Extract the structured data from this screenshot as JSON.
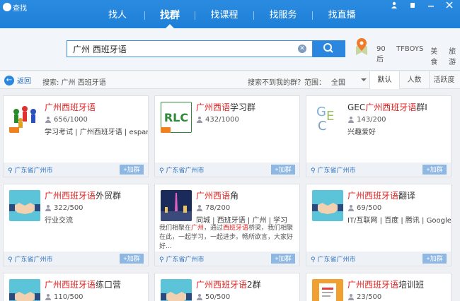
{
  "app": {
    "title": "查找"
  },
  "nav": [
    {
      "label": "找人",
      "active": false
    },
    {
      "label": "找群",
      "active": true
    },
    {
      "label": "找课程",
      "active": false
    },
    {
      "label": "找服务",
      "active": false
    },
    {
      "label": "找直播",
      "active": false
    }
  ],
  "search": {
    "value": "广州 西班牙语",
    "hot_tags": [
      "90后",
      "TFBOYS",
      "美食",
      "旅游"
    ]
  },
  "filter": {
    "back_label": "返回",
    "search_info": "搜索: 广州 西班牙语",
    "not_found": "搜索不到我的群？",
    "range_label": "范围：",
    "range_value": "全国",
    "sort_tabs": [
      {
        "label": "默认",
        "active": true
      },
      {
        "label": "人数",
        "active": false
      },
      {
        "label": "活跃度",
        "active": false
      }
    ]
  },
  "cards": [
    {
      "name_hl": "广州西班牙语",
      "name_rest": "",
      "count": "656/1000",
      "tags": "学习考试 | 广州西班牙语 | espanol",
      "desc_parts": [],
      "location": "广东省广州市",
      "join": "+加群",
      "thumb": "people"
    },
    {
      "name_hl": "广州西",
      "name_mid": "语",
      "name_rest": "学习群",
      "count": "432/1000",
      "tags": "",
      "desc_parts": [],
      "location": "广东省广州市",
      "join": "+加群",
      "thumb": "rlc"
    },
    {
      "name_pre": "GEC",
      "name_hl": "广州西班牙语",
      "name_rest": "群I",
      "count": "143/200",
      "tags": "兴趣爱好",
      "desc_parts": [],
      "location": "广东省广州市",
      "join": "+加群",
      "thumb": "gec"
    },
    {
      "name_hl": "广州西班牙语",
      "name_rest": "外贸群",
      "count": "322/500",
      "tags": "行业交流",
      "desc_parts": [],
      "location": "广东省广州市",
      "join": "+加群",
      "thumb": "hand"
    },
    {
      "name_hl": "广州西",
      "name_mid": "语",
      "name_rest": "角",
      "count": "78/200",
      "tags": "同城 | 西班牙语 | 广州 | 学习",
      "desc_parts": [
        {
          "t": "我们相聚在",
          "h": false
        },
        {
          "t": "广州",
          "h": true
        },
        {
          "t": "，通过",
          "h": false
        },
        {
          "t": "西班牙语",
          "h": true
        },
        {
          "t": "桥梁，我们相聚在此，一起学习，一起进步。畅所欲言，大家好好...",
          "h": false
        }
      ],
      "location": "广东省广州市",
      "join": "+加群",
      "thumb": "tower"
    },
    {
      "name_hl": "广州西班牙语",
      "name_rest": "翻译",
      "count": "69/500",
      "tags": "IT/互联网 | 百度 | 腾讯 | Google",
      "desc_parts": [],
      "location": "广东省广州市",
      "join": "+加群",
      "thumb": "hand"
    },
    {
      "name_hl": "广州西班牙语",
      "name_rest": "练口营",
      "count": "110/500",
      "tags": "",
      "desc_parts": [],
      "location": "",
      "join": "",
      "thumb": "hand"
    },
    {
      "name_hl": "广州西班牙语",
      "name_rest": "2群",
      "count": "50/500",
      "tags": "",
      "desc_parts": [],
      "location": "",
      "join": "",
      "thumb": "hand"
    },
    {
      "name_hl": "广州西班牙语",
      "name_rest": "培训班",
      "count": "23/500",
      "tags": "",
      "desc_parts": [],
      "location": "",
      "join": "",
      "thumb": "book"
    }
  ]
}
